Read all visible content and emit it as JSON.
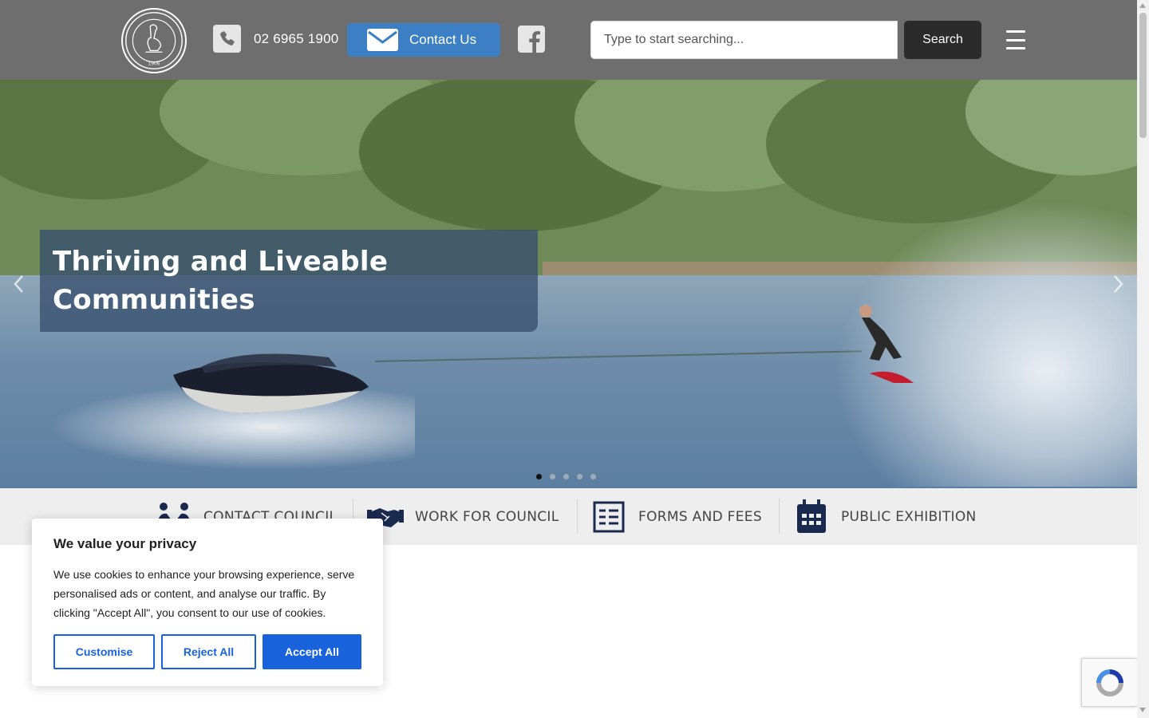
{
  "header": {
    "logo_alt": "Carrathool Shire Council 1906",
    "logo_text": "CARRATHOOL SHIRE COUNCIL",
    "logo_year": "1906",
    "phone": "02 6965 1900",
    "contact_label": "Contact Us",
    "search_placeholder": "Type to start searching...",
    "search_button": "Search"
  },
  "hero": {
    "title_line1": "Thriving and Liveable",
    "title_line2": "Communities",
    "slides": [
      true,
      false,
      false,
      false,
      false
    ]
  },
  "quick_links": [
    {
      "label": "CONTACT COUNCIL",
      "icon": "people-icon"
    },
    {
      "label": "WORK FOR COUNCIL",
      "icon": "handshake-icon"
    },
    {
      "label": "FORMS AND FEES",
      "icon": "form-icon"
    },
    {
      "label": "PUBLIC EXHIBITION",
      "icon": "calendar-icon"
    }
  ],
  "cookie": {
    "title": "We value your privacy",
    "body": "We use cookies to enhance your browsing experience, serve personalised ads or content, and analyse our traffic. By clicking \"Accept All\", you consent to our use of cookies.",
    "customise": "Customise",
    "reject": "Reject All",
    "accept": "Accept All"
  },
  "colors": {
    "header_bg": "#6e6e6e",
    "contact_bg": "#3d7fc4",
    "caption_bg": "#37506e",
    "quick_icon": "#1a2a4f",
    "cookie_accent": "#1863dc"
  }
}
